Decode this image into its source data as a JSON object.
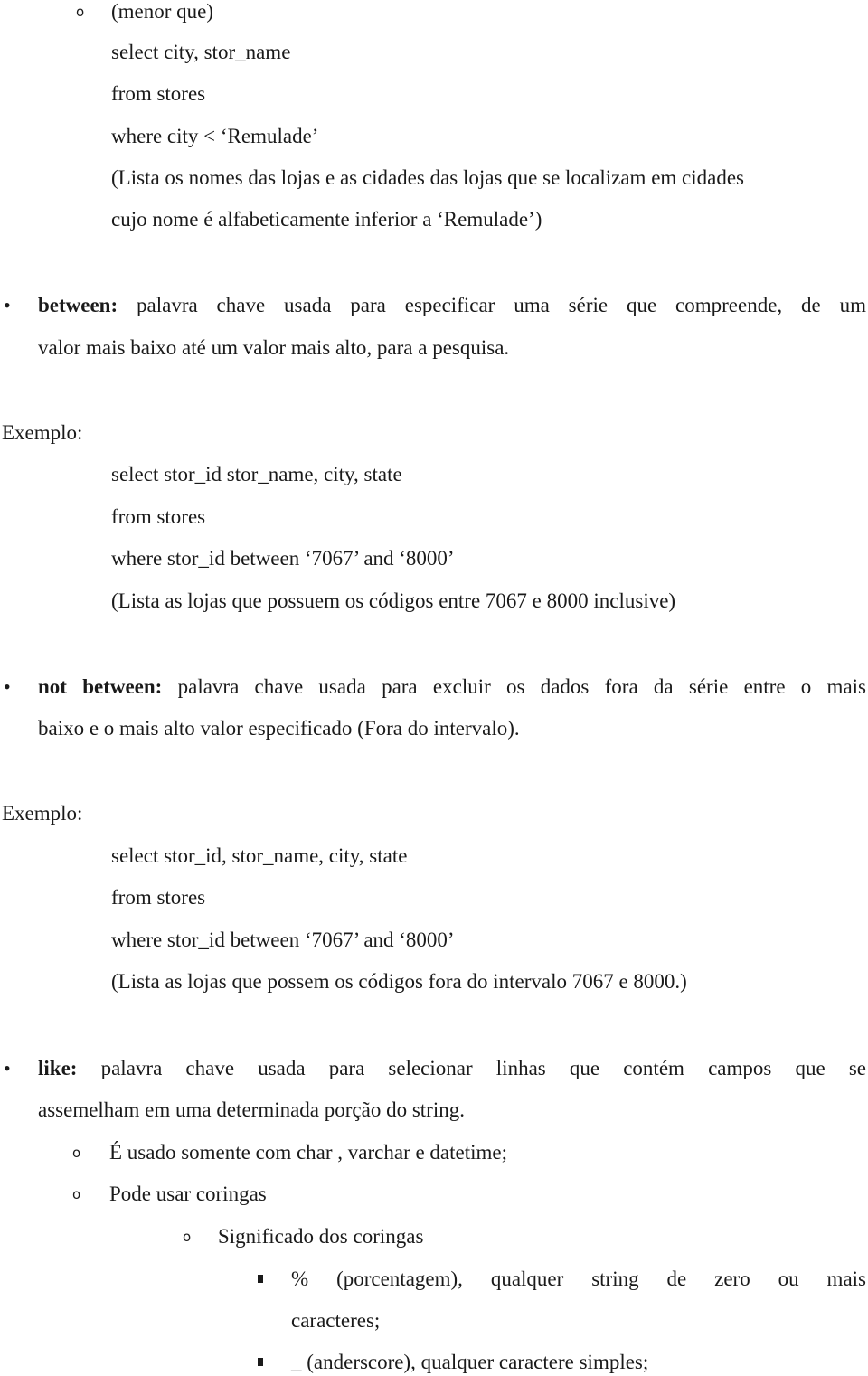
{
  "document": {
    "menor_que": {
      "marker": "o",
      "label": "(menor que)",
      "code": [
        "select city, stor_name",
        "from stores",
        "where city < ‘Remulade’"
      ],
      "note_lines": [
        "(Lista os nomes das lojas e as cidades das lojas que se localizam em cidades",
        "cujo nome é alfabeticamente inferior a ‘Remulade’)"
      ]
    },
    "between": {
      "keyword": "between:",
      "desc_line1": " palavra chave usada para especificar uma série que compreende, de um",
      "desc_line2": "valor mais baixo até um valor mais alto, para a pesquisa.",
      "example_label": "Exemplo:",
      "code": [
        "select stor_id stor_name, city, state",
        "from stores",
        "where stor_id between ‘7067’ and ‘8000’"
      ],
      "note": "(Lista as lojas que possuem os códigos entre 7067 e 8000 inclusive)"
    },
    "not_between": {
      "keyword": "not between:",
      "desc_line1": " palavra chave usada para excluir os dados fora da série entre o mais",
      "desc_line2": "baixo e o mais alto valor especificado (Fora do intervalo).",
      "example_label": "Exemplo:",
      "code": [
        "select stor_id, stor_name, city, state",
        "from stores",
        "where stor_id between ‘7067’ and ‘8000’"
      ],
      "note": "(Lista as lojas que possem os códigos fora do intervalo 7067 e 8000.)"
    },
    "like": {
      "keyword": "like:",
      "desc_line1": " palavra chave usada para selecionar linhas que contém campos que se",
      "desc_line2": "assemelham em uma determinada porção do string.",
      "sub_items": [
        "É usado somente com char , varchar e datetime;",
        "Pode usar coringas"
      ],
      "wildcards_title": "Significado dos coringas",
      "wildcards": [
        {
          "line1": "% (porcentagem), qualquer string de zero ou mais",
          "line2": "caracteres;"
        },
        {
          "line1": "_ (anderscore), qualquer caractere simples;"
        }
      ]
    },
    "markers": {
      "bullet": "•",
      "circle": "o"
    }
  }
}
